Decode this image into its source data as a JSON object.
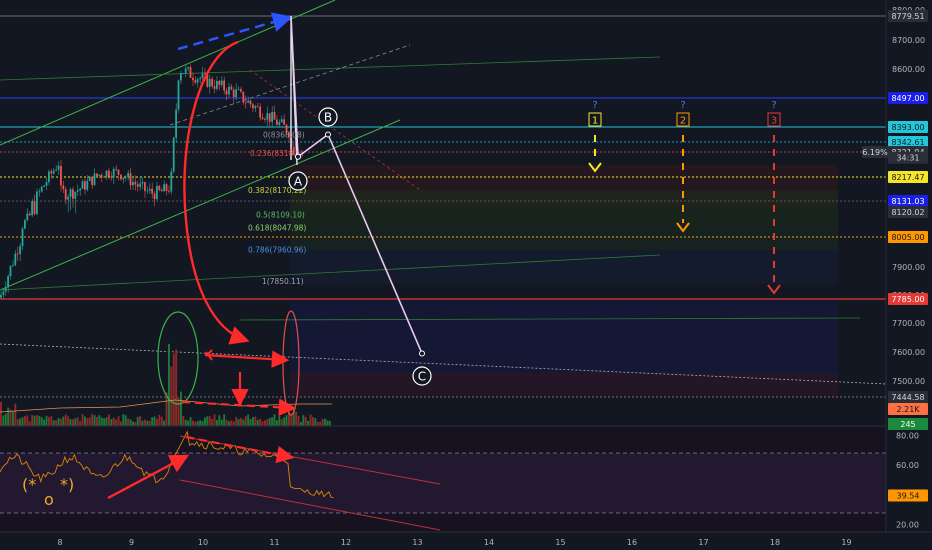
{
  "chart_data": [
    {
      "type": "line",
      "panel": "price",
      "y_axis_ticks": [
        "8800.00",
        "8700.00",
        "8600.00",
        "7900.00",
        "7800.00",
        "7700.00",
        "7600.00",
        "7500.00"
      ],
      "price_labels": [
        {
          "text": "8779.51",
          "value": 8779.51,
          "bg": "#2a2e39",
          "fg": "#d1d4dc"
        },
        {
          "text": "8497.00",
          "value": 8497.0,
          "bg": "#1b1ee6",
          "fg": "#ffffff"
        },
        {
          "text": "8393.00",
          "value": 8393.0,
          "bg": "#26c6da",
          "fg": "#0b1f24"
        },
        {
          "text": "8342.61",
          "value": 8342.61,
          "bg": "#26c6da",
          "fg": "#0b1f24"
        },
        {
          "text": "8321.94",
          "value": 8321.94,
          "bg": "#2a2e39",
          "fg": "#d1d4dc"
        },
        {
          "text": "34:31",
          "value": 8298.0,
          "bg": "#2a2e39",
          "fg": "#d1d4dc"
        },
        {
          "text": "8217.47",
          "value": 8217.47,
          "bg": "#f5e629",
          "fg": "#131722"
        },
        {
          "text": "8131.03",
          "value": 8131.03,
          "bg": "#1b1ee6",
          "fg": "#ffffff"
        },
        {
          "text": "8120.02",
          "value": 8120.02,
          "bg": "#2a2e39",
          "fg": "#d1d4dc"
        },
        {
          "text": "8005.00",
          "value": 8005.0,
          "bg": "#ff9800",
          "fg": "#131722"
        },
        {
          "text": "7785.00",
          "value": 7785.0,
          "bg": "#e53935",
          "fg": "#ffffff"
        },
        {
          "text": "7444.58",
          "value": 7444.58,
          "bg": "#2a2e39",
          "fg": "#d1d4dc"
        }
      ],
      "change_badge": {
        "text": "6.19%",
        "bg": "#2a2e39",
        "fg": "#d1d4dc"
      },
      "fib_levels": [
        {
          "text": "0(8368.08)",
          "value": 8368.08,
          "color": "#8f9099"
        },
        {
          "text": "0.236(8318.5)",
          "value": 8318.5,
          "color": "#e05050"
        },
        {
          "text": "0.382(8170.22)",
          "value": 8170.22,
          "color": "#c8d33b"
        },
        {
          "text": "0.5(8109.10)",
          "value": 8109.1,
          "color": "#5fbf5f"
        },
        {
          "text": "0.618(8047.98)",
          "value": 8047.98,
          "color": "#8fd06a"
        },
        {
          "text": "0.786(7960.96)",
          "value": 7960.96,
          "color": "#4a90e2"
        },
        {
          "text": "1(7850.11)",
          "value": 7850.11,
          "color": "#a0a3ab"
        }
      ],
      "wave_labels": [
        "A",
        "B",
        "C"
      ],
      "wave_points": [
        {
          "label": "A",
          "x": "11.3",
          "y": 8302
        },
        {
          "label": "B",
          "x": "11.6",
          "y": 8368
        },
        {
          "label": "C",
          "x": "12.9",
          "y": 7595
        }
      ],
      "scenarios": [
        {
          "label": "1",
          "question": "?",
          "color": "#f5e629",
          "target": 8217.47
        },
        {
          "label": "2",
          "question": "?",
          "color": "#ff9800",
          "target": 8005.0
        },
        {
          "label": "3",
          "question": "?",
          "color": "#e53935",
          "target": 7785.0
        }
      ],
      "x_axis_ticks": [
        "8",
        "9",
        "10",
        "11",
        "12",
        "13",
        "14",
        "15",
        "16",
        "17",
        "18",
        "19"
      ]
    },
    {
      "type": "bar",
      "panel": "volume",
      "value_labels": [
        {
          "text": "2.21K",
          "bg": "#ff7043",
          "fg": "#131722"
        },
        {
          "text": "245",
          "bg": "#1b8a3c",
          "fg": "#ffffff"
        }
      ]
    },
    {
      "type": "line",
      "panel": "oscillator",
      "y_axis_ticks": [
        "80.00",
        "60.00",
        "40.00",
        "20.00"
      ],
      "ylim": [
        15,
        85
      ],
      "current_value": {
        "text": "39.54",
        "value": 39.54,
        "bg": "#ff9800",
        "fg": "#131722"
      },
      "face_text": [
        "(*",
        "*)",
        "o"
      ]
    }
  ]
}
